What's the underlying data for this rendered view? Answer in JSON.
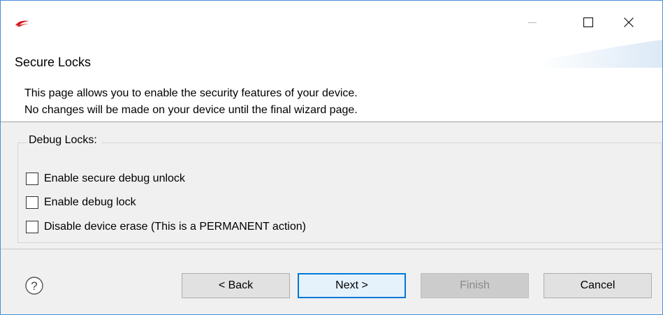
{
  "window": {
    "icons": {
      "app": "silicon-labs-logo-icon",
      "minimize": "minimize-icon",
      "maximize": "maximize-icon",
      "close": "close-icon"
    },
    "accent_color": "#4a90d9"
  },
  "header": {
    "title": "Secure Locks",
    "description_lines": [
      "This page allows you to enable the security features of your device.",
      "No changes will be made on your device until the final wizard page."
    ]
  },
  "debug_locks": {
    "label": "Debug Locks:",
    "options": [
      {
        "label": "Enable secure debug unlock",
        "checked": false
      },
      {
        "label": "Enable debug lock",
        "checked": false
      },
      {
        "label": "Disable device erase (This is a PERMANENT action)",
        "checked": false
      }
    ]
  },
  "footer": {
    "help_icon": "help-icon",
    "buttons": {
      "back": "< Back",
      "next": "Next >",
      "finish": "Finish",
      "cancel": "Cancel"
    },
    "finish_enabled": false,
    "default_button_color": "#0078d7"
  }
}
